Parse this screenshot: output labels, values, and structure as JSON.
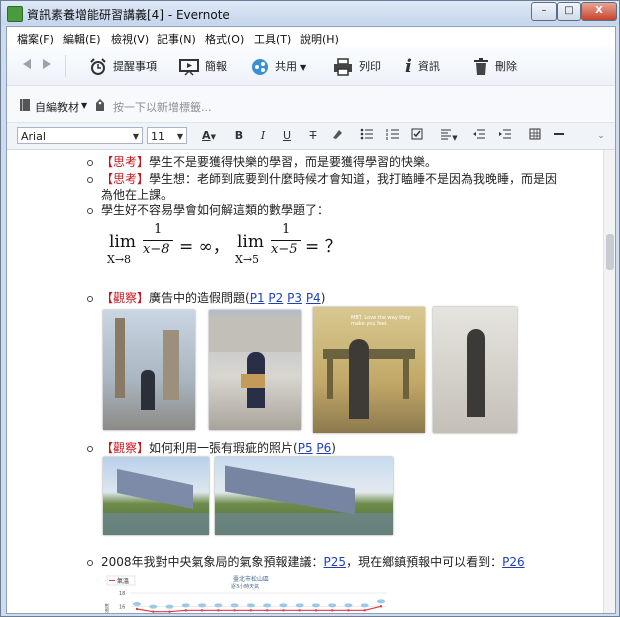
{
  "window": {
    "title": "資訊素養增能研習講義[4] - Evernote",
    "min_label": "–",
    "max_label": "□",
    "close_label": "X"
  },
  "menu": [
    "檔案(F)",
    "編輯(E)",
    "檢視(V)",
    "記事(N)",
    "格式(O)",
    "工具(T)",
    "說明(H)"
  ],
  "toolbar": {
    "reminder": "提醒事項",
    "present": "簡報",
    "share": "共用",
    "print": "列印",
    "info": "資訊",
    "delete": "刪除"
  },
  "notebook": {
    "name": "自編教材",
    "tag_placeholder": "按一下以新增標籤..."
  },
  "format": {
    "font": "Arial",
    "size": "11",
    "color_letter": "A",
    "bold": "B",
    "italic": "I",
    "underline": "U",
    "strike": "T"
  },
  "content": {
    "b1_tag": "【思考】",
    "b1_text": "學生不是要獲得快樂的學習，而是要獲得學習的快樂。",
    "b2_tag": "【思考】",
    "b2_text1": "學生想：老師到底要到什麼時候才會知道，我打瞌睡不是因為我晚睡，而是因",
    "b2_text2": "為他在上課。",
    "b3_text": "學生好不容易學會如何解這類的數學題了：",
    "math": {
      "lim": "lim",
      "sub1": "X→8",
      "num1": "1",
      "den1": "x−8",
      "eq1": "= ∞，",
      "sub2": "X→5",
      "num2": "1",
      "den2": "x−5",
      "eq2": "=  ？"
    },
    "b4_tag": "【觀察】",
    "b4_text": "廣告中的造假問題(",
    "b4_links": [
      "P1",
      "P2",
      "P3",
      "P4"
    ],
    "b4_close": ")",
    "b5_tag": "【觀察】",
    "b5_text": "如何利用一張有瑕疵的照片(",
    "b5_links": [
      "P5",
      "P6"
    ],
    "b5_close": ")",
    "b6_text1": "2008年我對中央氣象局的氣象預報建議：",
    "b6_link1": "P25",
    "b6_text2": "，現在鄉鎮預報中可以看到：",
    "b6_link2": "P26",
    "ad_text": "MBT. Love the way they make you feel."
  },
  "chart_data": {
    "type": "line",
    "title": "臺北市松山區",
    "subtitle": "逐3小時天氣",
    "legend": [
      "氣溫"
    ],
    "ylabel": "溫度",
    "yticks": [
      18,
      16
    ],
    "series": [
      {
        "name": "氣溫",
        "values": [
          15.6,
          15.2,
          15.2,
          15.4,
          15.4,
          15.4,
          15.4,
          15.4,
          15.4,
          15.4,
          15.4,
          15.4,
          15.4,
          15.4,
          15.4,
          16
        ]
      }
    ],
    "colors": {
      "line": "#e33b3b",
      "bubbles": "#9cc8ea"
    }
  }
}
